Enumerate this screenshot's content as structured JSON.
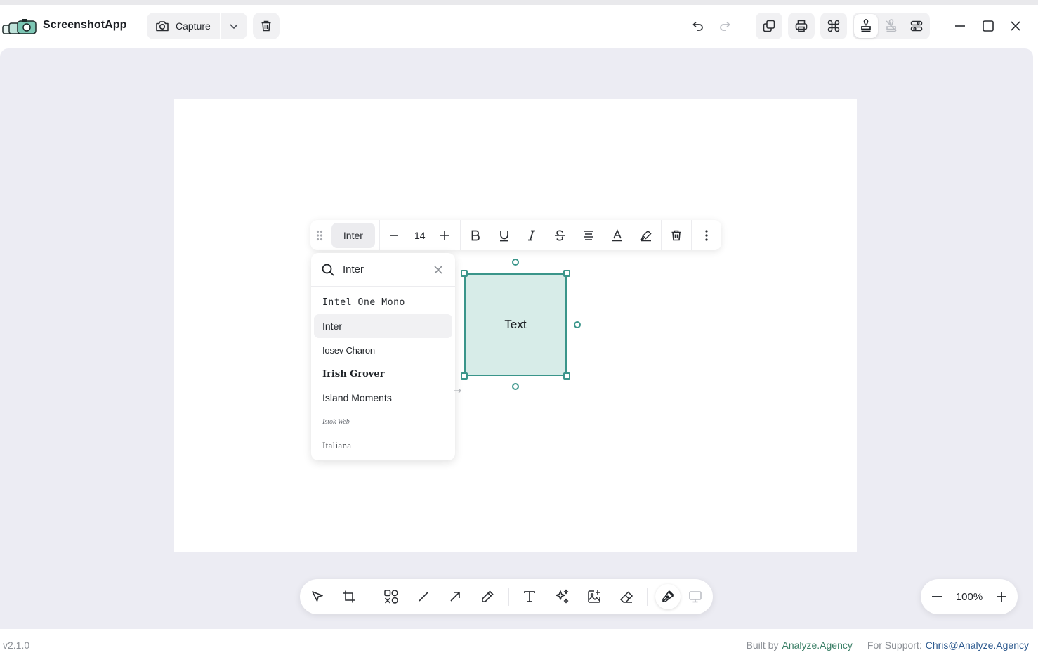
{
  "app": {
    "name": "ScreenshotApp",
    "version": "v2.1.0"
  },
  "titlebar": {
    "capture_label": "Capture",
    "icons": [
      "undo-icon",
      "redo-icon",
      "copy-icon",
      "print-icon",
      "command-icon",
      "stamp-icon",
      "stamp-outline-icon",
      "settings-icon",
      "minimize-icon",
      "maximize-icon",
      "close-icon"
    ]
  },
  "format_toolbar": {
    "font_name": "Inter",
    "font_size": "14"
  },
  "font_dropdown": {
    "search_value": "Inter",
    "items": [
      {
        "label": "Intel One Mono",
        "selected": false
      },
      {
        "label": "Inter",
        "selected": true
      },
      {
        "label": "Iosev Charon",
        "selected": false
      },
      {
        "label": "Irish Grover",
        "selected": false
      },
      {
        "label": "Island Moments",
        "selected": false
      },
      {
        "label": "Istok Web",
        "selected": false
      },
      {
        "label": "Italiana",
        "selected": false
      }
    ]
  },
  "canvas": {
    "shape_text": "Text",
    "shape_fill": "#d7ece8",
    "shape_stroke": "#3a958a"
  },
  "bottom_toolbar": {
    "tools": [
      "select-tool",
      "crop-tool",
      "shapes-tool",
      "line-tool",
      "arrow-tool",
      "pencil-tool",
      "text-tool",
      "ai-sparkle-tool",
      "image-add-tool",
      "eraser-tool",
      "pen-tool",
      "presentation-tool"
    ]
  },
  "zoom": {
    "value": "100%"
  },
  "footer": {
    "built_by_label": "Built by",
    "built_by_link": "Analyze.Agency",
    "support_label": "For Support:",
    "support_link": "Chris@Analyze.Agency"
  }
}
